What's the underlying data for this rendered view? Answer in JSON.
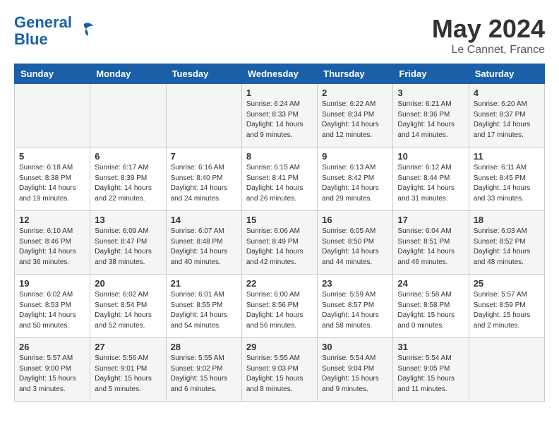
{
  "header": {
    "logo_line1": "General",
    "logo_line2": "Blue",
    "month": "May 2024",
    "location": "Le Cannet, France"
  },
  "days_of_week": [
    "Sunday",
    "Monday",
    "Tuesday",
    "Wednesday",
    "Thursday",
    "Friday",
    "Saturday"
  ],
  "weeks": [
    [
      {
        "date": "",
        "sunrise": "",
        "sunset": "",
        "daylight": ""
      },
      {
        "date": "",
        "sunrise": "",
        "sunset": "",
        "daylight": ""
      },
      {
        "date": "",
        "sunrise": "",
        "sunset": "",
        "daylight": ""
      },
      {
        "date": "1",
        "sunrise": "Sunrise: 6:24 AM",
        "sunset": "Sunset: 8:33 PM",
        "daylight": "Daylight: 14 hours and 9 minutes."
      },
      {
        "date": "2",
        "sunrise": "Sunrise: 6:22 AM",
        "sunset": "Sunset: 8:34 PM",
        "daylight": "Daylight: 14 hours and 12 minutes."
      },
      {
        "date": "3",
        "sunrise": "Sunrise: 6:21 AM",
        "sunset": "Sunset: 8:36 PM",
        "daylight": "Daylight: 14 hours and 14 minutes."
      },
      {
        "date": "4",
        "sunrise": "Sunrise: 6:20 AM",
        "sunset": "Sunset: 8:37 PM",
        "daylight": "Daylight: 14 hours and 17 minutes."
      }
    ],
    [
      {
        "date": "5",
        "sunrise": "Sunrise: 6:18 AM",
        "sunset": "Sunset: 8:38 PM",
        "daylight": "Daylight: 14 hours and 19 minutes."
      },
      {
        "date": "6",
        "sunrise": "Sunrise: 6:17 AM",
        "sunset": "Sunset: 8:39 PM",
        "daylight": "Daylight: 14 hours and 22 minutes."
      },
      {
        "date": "7",
        "sunrise": "Sunrise: 6:16 AM",
        "sunset": "Sunset: 8:40 PM",
        "daylight": "Daylight: 14 hours and 24 minutes."
      },
      {
        "date": "8",
        "sunrise": "Sunrise: 6:15 AM",
        "sunset": "Sunset: 8:41 PM",
        "daylight": "Daylight: 14 hours and 26 minutes."
      },
      {
        "date": "9",
        "sunrise": "Sunrise: 6:13 AM",
        "sunset": "Sunset: 8:42 PM",
        "daylight": "Daylight: 14 hours and 29 minutes."
      },
      {
        "date": "10",
        "sunrise": "Sunrise: 6:12 AM",
        "sunset": "Sunset: 8:44 PM",
        "daylight": "Daylight: 14 hours and 31 minutes."
      },
      {
        "date": "11",
        "sunrise": "Sunrise: 6:11 AM",
        "sunset": "Sunset: 8:45 PM",
        "daylight": "Daylight: 14 hours and 33 minutes."
      }
    ],
    [
      {
        "date": "12",
        "sunrise": "Sunrise: 6:10 AM",
        "sunset": "Sunset: 8:46 PM",
        "daylight": "Daylight: 14 hours and 36 minutes."
      },
      {
        "date": "13",
        "sunrise": "Sunrise: 6:09 AM",
        "sunset": "Sunset: 8:47 PM",
        "daylight": "Daylight: 14 hours and 38 minutes."
      },
      {
        "date": "14",
        "sunrise": "Sunrise: 6:07 AM",
        "sunset": "Sunset: 8:48 PM",
        "daylight": "Daylight: 14 hours and 40 minutes."
      },
      {
        "date": "15",
        "sunrise": "Sunrise: 6:06 AM",
        "sunset": "Sunset: 8:49 PM",
        "daylight": "Daylight: 14 hours and 42 minutes."
      },
      {
        "date": "16",
        "sunrise": "Sunrise: 6:05 AM",
        "sunset": "Sunset: 8:50 PM",
        "daylight": "Daylight: 14 hours and 44 minutes."
      },
      {
        "date": "17",
        "sunrise": "Sunrise: 6:04 AM",
        "sunset": "Sunset: 8:51 PM",
        "daylight": "Daylight: 14 hours and 46 minutes."
      },
      {
        "date": "18",
        "sunrise": "Sunrise: 6:03 AM",
        "sunset": "Sunset: 8:52 PM",
        "daylight": "Daylight: 14 hours and 48 minutes."
      }
    ],
    [
      {
        "date": "19",
        "sunrise": "Sunrise: 6:02 AM",
        "sunset": "Sunset: 8:53 PM",
        "daylight": "Daylight: 14 hours and 50 minutes."
      },
      {
        "date": "20",
        "sunrise": "Sunrise: 6:02 AM",
        "sunset": "Sunset: 8:54 PM",
        "daylight": "Daylight: 14 hours and 52 minutes."
      },
      {
        "date": "21",
        "sunrise": "Sunrise: 6:01 AM",
        "sunset": "Sunset: 8:55 PM",
        "daylight": "Daylight: 14 hours and 54 minutes."
      },
      {
        "date": "22",
        "sunrise": "Sunrise: 6:00 AM",
        "sunset": "Sunset: 8:56 PM",
        "daylight": "Daylight: 14 hours and 56 minutes."
      },
      {
        "date": "23",
        "sunrise": "Sunrise: 5:59 AM",
        "sunset": "Sunset: 8:57 PM",
        "daylight": "Daylight: 14 hours and 58 minutes."
      },
      {
        "date": "24",
        "sunrise": "Sunrise: 5:58 AM",
        "sunset": "Sunset: 8:58 PM",
        "daylight": "Daylight: 15 hours and 0 minutes."
      },
      {
        "date": "25",
        "sunrise": "Sunrise: 5:57 AM",
        "sunset": "Sunset: 8:59 PM",
        "daylight": "Daylight: 15 hours and 2 minutes."
      }
    ],
    [
      {
        "date": "26",
        "sunrise": "Sunrise: 5:57 AM",
        "sunset": "Sunset: 9:00 PM",
        "daylight": "Daylight: 15 hours and 3 minutes."
      },
      {
        "date": "27",
        "sunrise": "Sunrise: 5:56 AM",
        "sunset": "Sunset: 9:01 PM",
        "daylight": "Daylight: 15 hours and 5 minutes."
      },
      {
        "date": "28",
        "sunrise": "Sunrise: 5:55 AM",
        "sunset": "Sunset: 9:02 PM",
        "daylight": "Daylight: 15 hours and 6 minutes."
      },
      {
        "date": "29",
        "sunrise": "Sunrise: 5:55 AM",
        "sunset": "Sunset: 9:03 PM",
        "daylight": "Daylight: 15 hours and 8 minutes."
      },
      {
        "date": "30",
        "sunrise": "Sunrise: 5:54 AM",
        "sunset": "Sunset: 9:04 PM",
        "daylight": "Daylight: 15 hours and 9 minutes."
      },
      {
        "date": "31",
        "sunrise": "Sunrise: 5:54 AM",
        "sunset": "Sunset: 9:05 PM",
        "daylight": "Daylight: 15 hours and 11 minutes."
      },
      {
        "date": "",
        "sunrise": "",
        "sunset": "",
        "daylight": ""
      }
    ]
  ]
}
